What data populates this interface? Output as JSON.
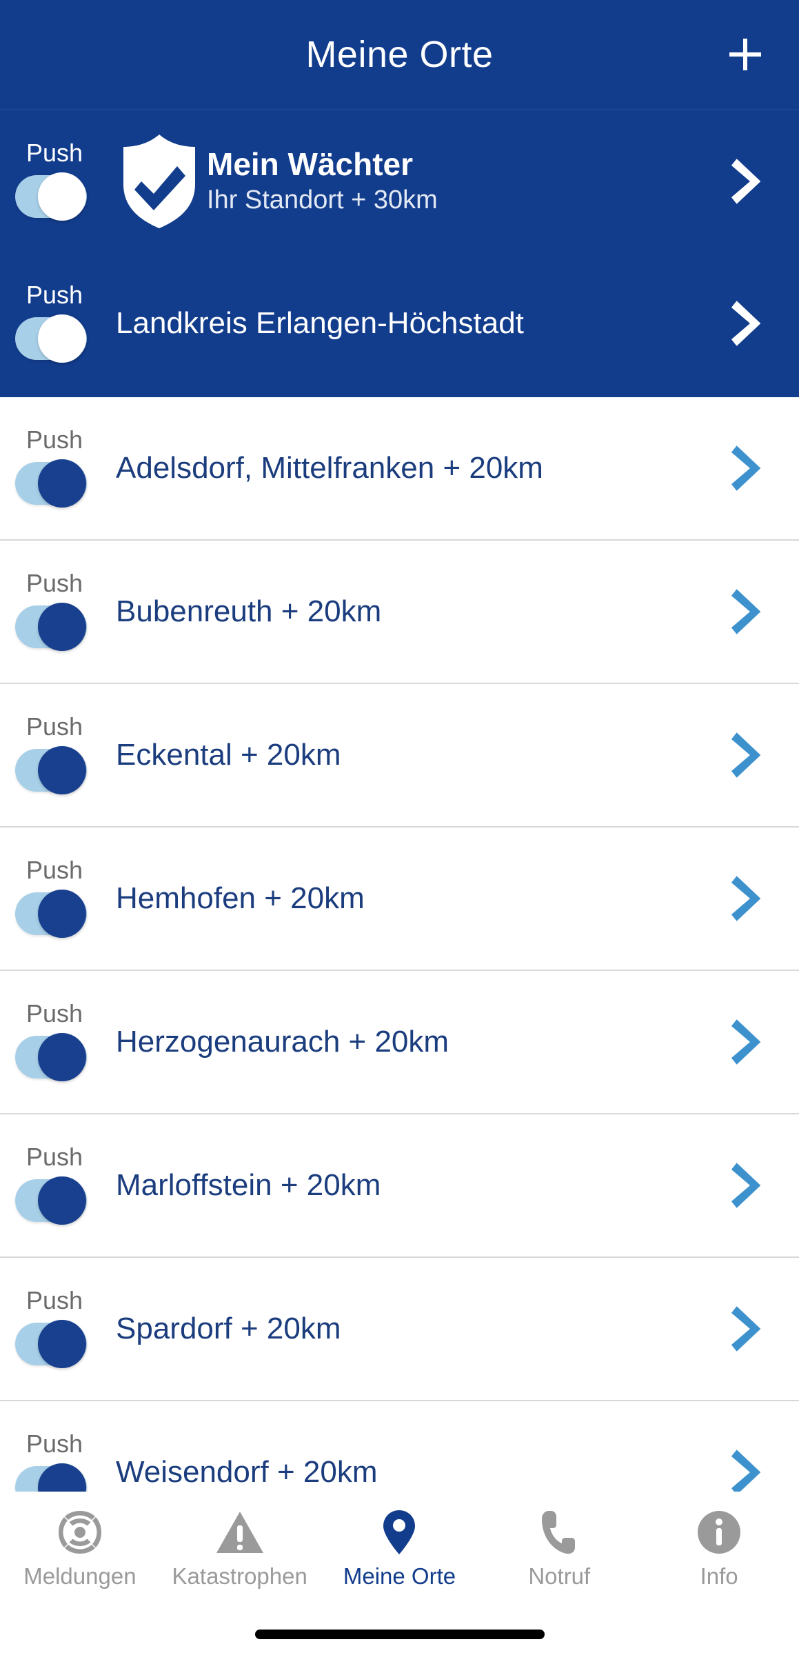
{
  "colors": {
    "brand_blue": "#123C8C",
    "toggle_track": "#a8cfe8",
    "toggle_knob_on_dark": "#18408f",
    "chevron_blue": "#3d92ce",
    "text_navy": "#1b3d7e",
    "tab_inactive": "#9a9a9a"
  },
  "header": {
    "title": "Meine Orte",
    "add_icon": "plus-icon"
  },
  "push_label": "Push",
  "highlight_rows": [
    {
      "icon": "shield-check-icon",
      "title": "Mein Wächter",
      "subtitle": "Ihr Standort + 30km",
      "push_label": "Push",
      "toggle_on": true,
      "chevron": "chevron-right-icon"
    },
    {
      "icon": null,
      "title": "Landkreis Erlangen-Höchstadt",
      "subtitle": null,
      "push_label": "Push",
      "toggle_on": true,
      "chevron": "chevron-right-icon"
    }
  ],
  "place_rows": [
    {
      "title": "Adelsdorf, Mittelfranken + 20km",
      "push_label": "Push",
      "toggle_on": true,
      "chevron": "chevron-right-icon"
    },
    {
      "title": "Bubenreuth + 20km",
      "push_label": "Push",
      "toggle_on": true,
      "chevron": "chevron-right-icon"
    },
    {
      "title": "Eckental + 20km",
      "push_label": "Push",
      "toggle_on": true,
      "chevron": "chevron-right-icon"
    },
    {
      "title": "Hemhofen + 20km",
      "push_label": "Push",
      "toggle_on": true,
      "chevron": "chevron-right-icon"
    },
    {
      "title": "Herzogenaurach + 20km",
      "push_label": "Push",
      "toggle_on": true,
      "chevron": "chevron-right-icon"
    },
    {
      "title": "Marloffstein + 20km",
      "push_label": "Push",
      "toggle_on": true,
      "chevron": "chevron-right-icon"
    },
    {
      "title": "Spardorf + 20km",
      "push_label": "Push",
      "toggle_on": true,
      "chevron": "chevron-right-icon"
    },
    {
      "title": "Weisendorf + 20km",
      "push_label": "Push",
      "toggle_on": true,
      "chevron": "chevron-right-icon"
    }
  ],
  "tabs": [
    {
      "label": "Meldungen",
      "icon": "siren-broadcast-icon",
      "active": false
    },
    {
      "label": "Katastrophen",
      "icon": "warning-triangle-icon",
      "active": false
    },
    {
      "label": "Meine Orte",
      "icon": "location-pin-icon",
      "active": true
    },
    {
      "label": "Notruf",
      "icon": "phone-icon",
      "active": false
    },
    {
      "label": "Info",
      "icon": "info-circle-icon",
      "active": false
    }
  ]
}
